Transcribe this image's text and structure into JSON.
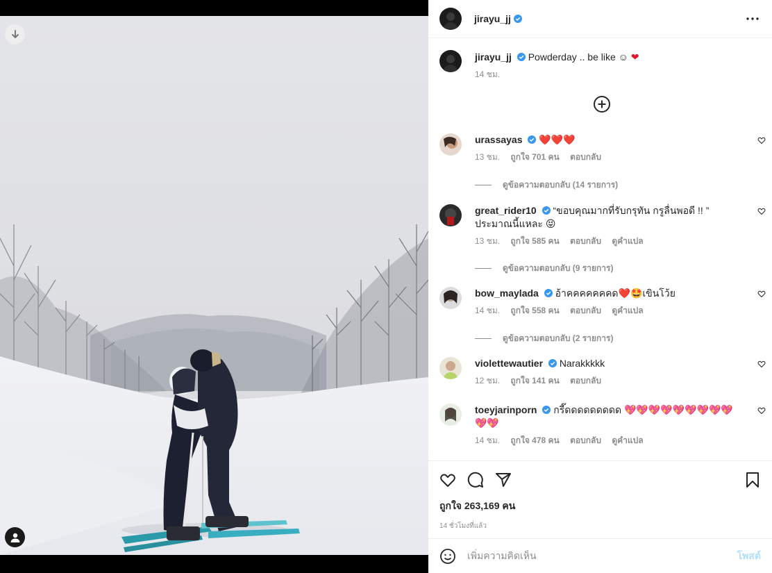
{
  "post": {
    "author": "jirayu_jj",
    "caption_text": "Powderday .. be like ☺",
    "caption_time": "14 ชม."
  },
  "comments": [
    {
      "user": "urassayas",
      "text": "",
      "emoji": "❤️❤️❤️",
      "time": "13 ชม.",
      "likes": "ถูกใจ 701 คน",
      "reply": "ตอบกลับ",
      "translate": "",
      "view_replies": "ดูข้อความตอบกลับ (14 รายการ)"
    },
    {
      "user": "great_rider10",
      "text": "“ขอบคุณมากที่รับกรุทัน กรูลื่นพอดี !! ” ประมาณนี้แหละ 😝",
      "emoji": "",
      "time": "13 ชม.",
      "likes": "ถูกใจ 585 คน",
      "reply": "ตอบกลับ",
      "translate": "ดูคำแปล",
      "view_replies": "ดูข้อความตอบกลับ (9 รายการ)"
    },
    {
      "user": "bow_maylada",
      "text": "อ้าคคคคคคคด❤️🤩เขินโว้ย",
      "emoji": "",
      "time": "14 ชม.",
      "likes": "ถูกใจ 558 คน",
      "reply": "ตอบกลับ",
      "translate": "ดูคำแปล",
      "view_replies": "ดูข้อความตอบกลับ (2 รายการ)"
    },
    {
      "user": "violettewautier",
      "text": "Narakkkkk",
      "emoji": "",
      "time": "12 ชม.",
      "likes": "ถูกใจ 141 คน",
      "reply": "ตอบกลับ",
      "translate": "",
      "view_replies": ""
    },
    {
      "user": "toeyjarinporn",
      "text": "กรี๊ดดดดดดดดด 💖💖💖💖💖💖💖💖💖💖💖",
      "emoji": "",
      "time": "14 ชม.",
      "likes": "ถูกใจ 478 คน",
      "reply": "ตอบกลับ",
      "translate": "ดูคำแปล",
      "view_replies": ""
    }
  ],
  "footer": {
    "likes": "ถูกใจ 263,169 คน",
    "time_ago": "14 ชั่วโมงที่แล้ว",
    "comment_placeholder": "เพิ่มความคิดเห็น",
    "post_label": "โพสต์"
  },
  "colors": {
    "verified": "#3897f0",
    "heart": "#e0162b",
    "muted": "#8e8e8e"
  }
}
